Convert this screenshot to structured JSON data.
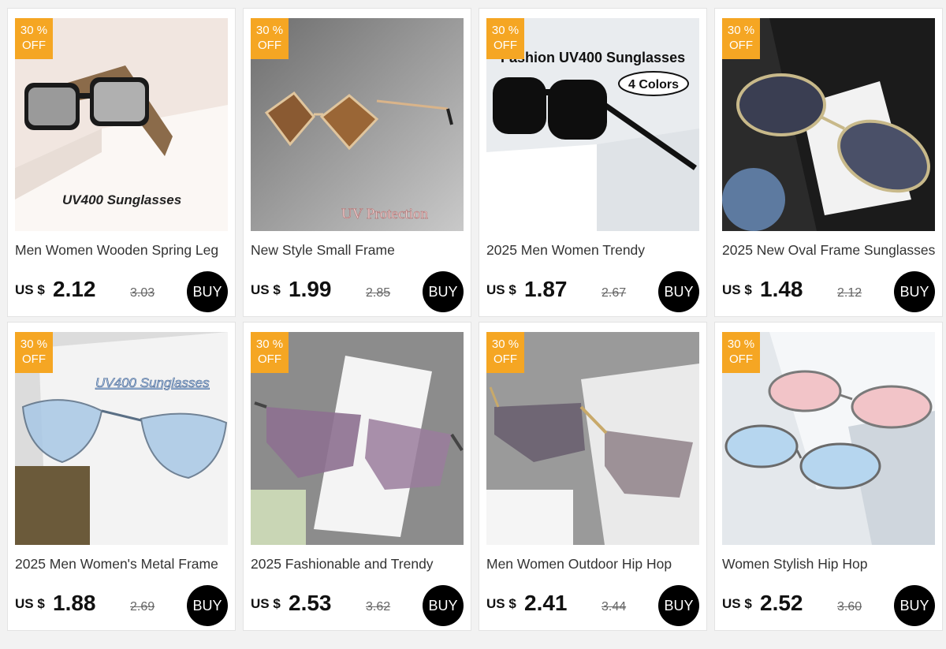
{
  "products": [
    {
      "title": "Men Women Wooden Spring Leg",
      "currency": "US $",
      "price": "2.12",
      "original_price": "3.03",
      "discount_pct": "30 %",
      "discount_off": "OFF",
      "buy_label": "BUY",
      "image_caption": "UV400 Sunglasses",
      "image_caption2": ""
    },
    {
      "title": "New Style Small Frame",
      "currency": "US $",
      "price": "1.99",
      "original_price": "2.85",
      "discount_pct": "30 %",
      "discount_off": "OFF",
      "buy_label": "BUY",
      "image_caption": "UV Protection",
      "image_caption2": ""
    },
    {
      "title": "2025 Men Women Trendy",
      "currency": "US $",
      "price": "1.87",
      "original_price": "2.67",
      "discount_pct": "30 %",
      "discount_off": "OFF",
      "buy_label": "BUY",
      "image_caption": "Fashion UV400 Sunglasses",
      "image_caption2": "4 Colors"
    },
    {
      "title": "2025 New Oval Frame Sunglasses",
      "currency": "US $",
      "price": "1.48",
      "original_price": "2.12",
      "discount_pct": "30 %",
      "discount_off": "OFF",
      "buy_label": "BUY",
      "image_caption": "",
      "image_caption2": ""
    },
    {
      "title": "2025 Men Women's Metal Frame",
      "currency": "US $",
      "price": "1.88",
      "original_price": "2.69",
      "discount_pct": "30 %",
      "discount_off": "OFF",
      "buy_label": "BUY",
      "image_caption": "UV400 Sunglasses",
      "image_caption2": ""
    },
    {
      "title": "2025 Fashionable and Trendy",
      "currency": "US $",
      "price": "2.53",
      "original_price": "3.62",
      "discount_pct": "30 %",
      "discount_off": "OFF",
      "buy_label": "BUY",
      "image_caption": "",
      "image_caption2": ""
    },
    {
      "title": "Men Women Outdoor Hip Hop",
      "currency": "US $",
      "price": "2.41",
      "original_price": "3.44",
      "discount_pct": "30 %",
      "discount_off": "OFF",
      "buy_label": "BUY",
      "image_caption": "",
      "image_caption2": ""
    },
    {
      "title": "Women Stylish Hip Hop",
      "currency": "US $",
      "price": "2.52",
      "original_price": "3.60",
      "discount_pct": "30 %",
      "discount_off": "OFF",
      "buy_label": "BUY",
      "image_caption": "",
      "image_caption2": ""
    }
  ],
  "colors": {
    "badge": "#f5a623",
    "buy_button": "#000000",
    "page_bg": "#f2f2f2"
  }
}
